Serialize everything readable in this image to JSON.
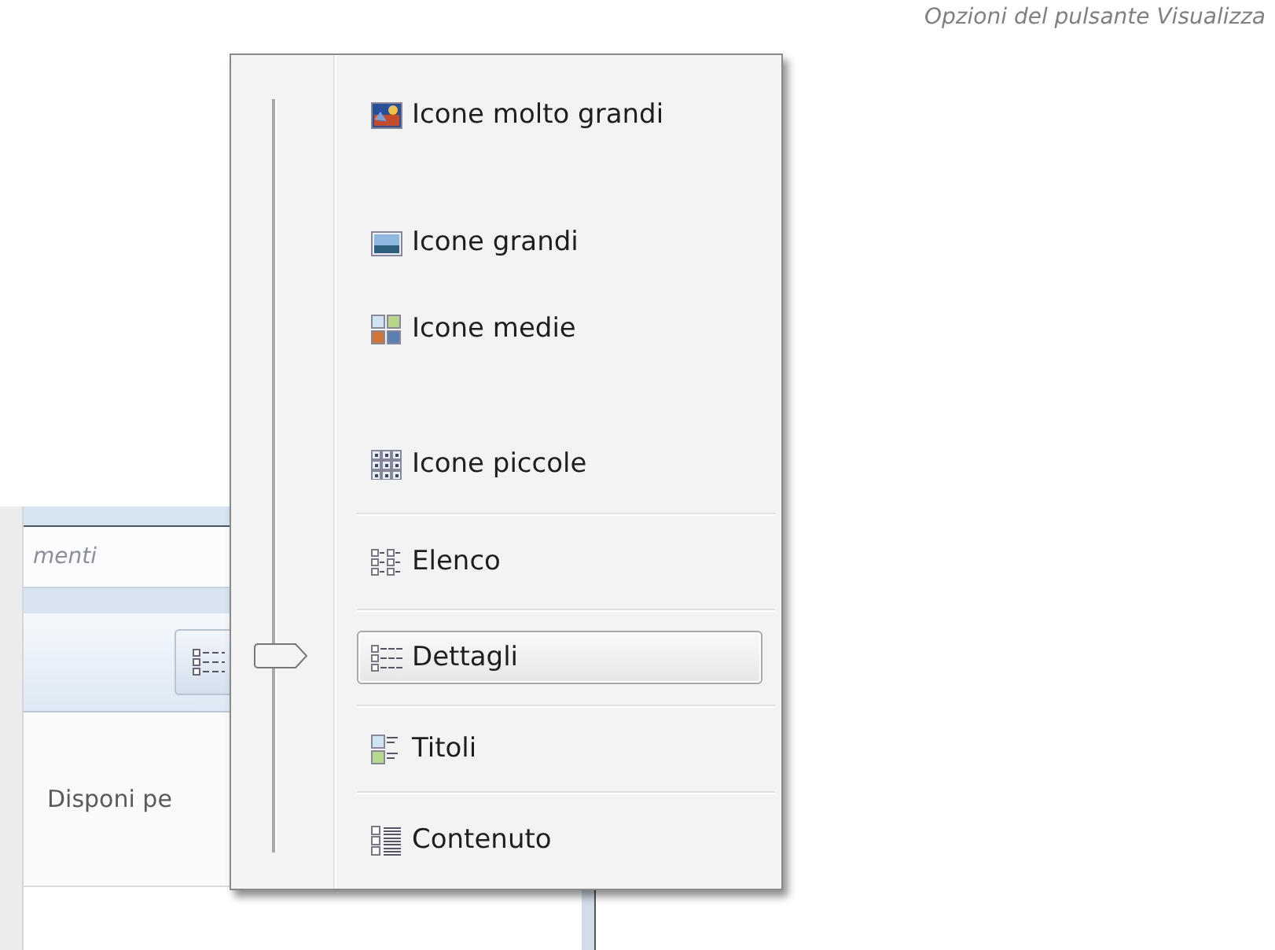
{
  "caption": "Opzioni del pulsante Visualizza",
  "background_window": {
    "search_field": {
      "placeholder": "menti"
    },
    "arrange_label": "Disponi pe"
  },
  "view_menu": {
    "slider": {
      "level": 0.26
    },
    "items": [
      {
        "label": "Icone molto grandi",
        "kind": "extra-large",
        "selected": false
      },
      {
        "label": "Icone grandi",
        "kind": "large",
        "selected": false
      },
      {
        "label": "Icone medie",
        "kind": "medium",
        "selected": false
      },
      {
        "label": "Icone piccole",
        "kind": "small",
        "selected": false
      },
      {
        "label": "Elenco",
        "kind": "list",
        "selected": false
      },
      {
        "label": "Dettagli",
        "kind": "details",
        "selected": true
      },
      {
        "label": "Titoli",
        "kind": "tiles",
        "selected": false
      },
      {
        "label": "Contenuto",
        "kind": "content",
        "selected": false
      }
    ]
  }
}
